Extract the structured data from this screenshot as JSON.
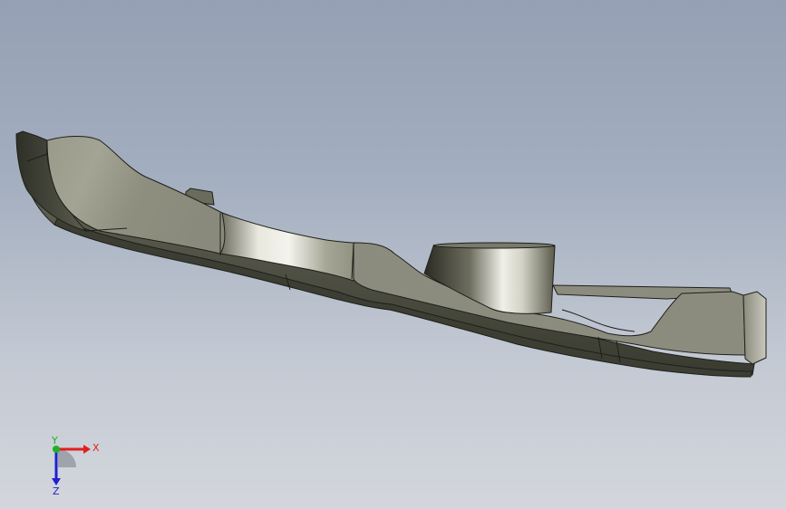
{
  "window": {
    "background_top": "#95a0b4",
    "background_bottom": "#d3d6dc"
  },
  "model": {
    "face_color": "#9e9e90",
    "shade_color": "#5f6052",
    "edge_color": "#1e1f1a"
  },
  "triad": {
    "x_label": "X",
    "y_label": "Y",
    "z_label": "Z",
    "x_color": "#e02020",
    "y_color": "#20b020",
    "z_color": "#2020d0"
  }
}
